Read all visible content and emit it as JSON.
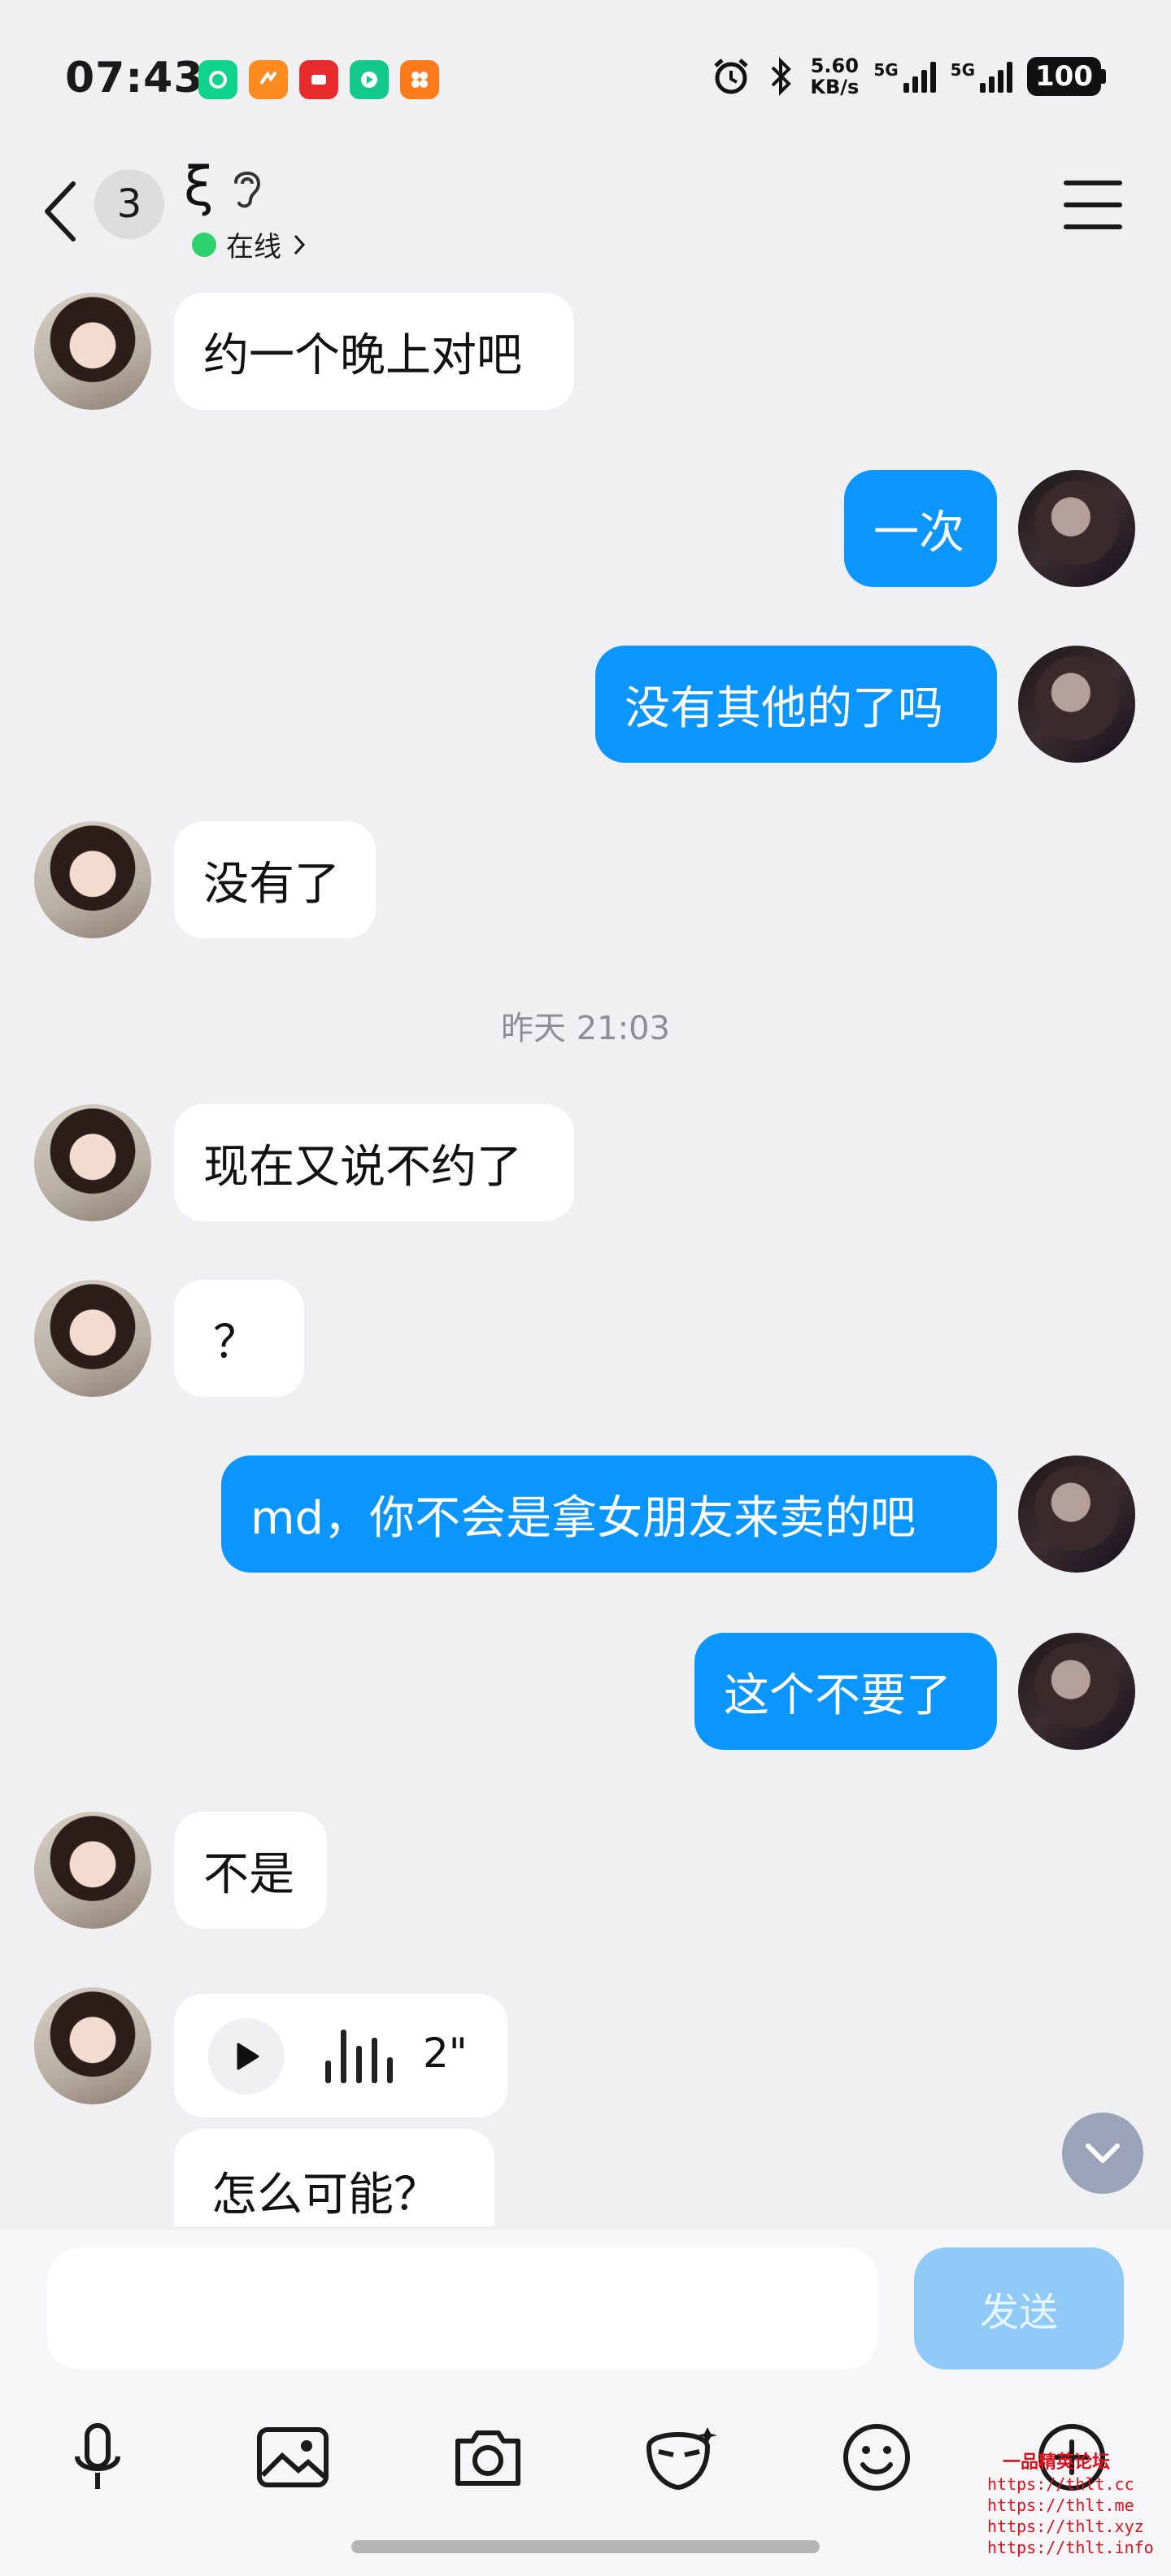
{
  "status_bar": {
    "time": "07:43",
    "net_speed_value": "5.60",
    "net_speed_unit": "KB/s",
    "sim1_label": "5G",
    "sim2_label": "5G",
    "battery": "100",
    "app_icon_colors": [
      "#0fd38b",
      "#ff8a1d",
      "#e72b2b",
      "#12c98b",
      "#ff7a1a"
    ]
  },
  "header": {
    "unread_count": "3",
    "contact_name": "ξ",
    "online_status": "在线",
    "online_color": "#2bd36a"
  },
  "messages": [
    {
      "side": "left",
      "text": "约一个晚上对吧"
    },
    {
      "side": "right",
      "text": "一次"
    },
    {
      "side": "right",
      "text": "没有其他的了吗"
    },
    {
      "side": "left",
      "text": "没有了"
    },
    {
      "side": "left",
      "text": "现在又说不约了"
    },
    {
      "side": "left",
      "text": "？"
    },
    {
      "side": "right",
      "text": "md，你不会是拿女朋友来卖的吧"
    },
    {
      "side": "right",
      "text": "这个不要了"
    },
    {
      "side": "left",
      "text": "不是"
    },
    {
      "side": "left",
      "text": "怎么可能？"
    }
  ],
  "time_separator": "昨天 21:03",
  "voice_message": {
    "duration": "2\""
  },
  "input": {
    "placeholder": "",
    "value": "",
    "send_label": "发送"
  },
  "toolbar": [
    "mic-icon",
    "image-icon",
    "camera-icon",
    "mask-icon",
    "emoji-icon",
    "plus-icon"
  ],
  "colors": {
    "accent": "#0a95ff",
    "background": "#f0f0f3",
    "send_disabled": "#8fcaf7"
  },
  "watermark": {
    "title": "一品精英论坛",
    "lines": [
      "https://thlt.cc",
      "https://thlt.me",
      "https://thlt.xyz",
      "https://thlt.info"
    ]
  }
}
